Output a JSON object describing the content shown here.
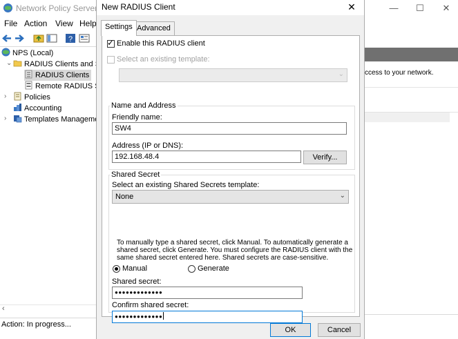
{
  "background_window": {
    "title": "Network Policy Server",
    "menu": [
      "File",
      "Action",
      "View",
      "Help"
    ],
    "tree": [
      {
        "label": "NPS (Local)"
      },
      {
        "label": "RADIUS Clients and Se"
      },
      {
        "label": "RADIUS Clients"
      },
      {
        "label": "Remote RADIUS Se"
      },
      {
        "label": "Policies"
      },
      {
        "label": "Accounting"
      },
      {
        "label": "Templates Manageme"
      }
    ],
    "status": "Action:  In progress...",
    "right_pane_text": "ccess to your network.",
    "caption_buttons": {
      "minimize": "—",
      "maximize": "☐",
      "close": "✕"
    }
  },
  "dialog": {
    "title": "New RADIUS Client",
    "close_glyph": "✕",
    "tabs": [
      "Settings",
      "Advanced"
    ],
    "enable_label": "Enable this RADIUS client",
    "enable_checked": true,
    "template_label": "Select an existing template:",
    "template_checked": false,
    "template_value": "",
    "name_group": "Name and Address",
    "friendly_label": "Friendly name:",
    "friendly_value": "SW4",
    "address_label": "Address (IP or DNS):",
    "address_value": "192.168.48.4",
    "verify_label": "Verify...",
    "secret_group": "Shared Secret",
    "secret_template_label": "Select an existing Shared Secrets template:",
    "secret_template_value": "None",
    "description": "To manually type a shared secret, click Manual. To automatically generate a shared secret, click Generate. You must configure the RADIUS client with the same shared secret entered here. Shared secrets are case-sensitive.",
    "manual_label": "Manual",
    "generate_label": "Generate",
    "selected_mode": "Manual",
    "shared_secret_label": "Shared secret:",
    "shared_secret_value": "●●●●●●●●●●●●●",
    "confirm_label": "Confirm shared secret:",
    "confirm_value": "●●●●●●●●●●●●●",
    "ok_label": "OK",
    "cancel_label": "Cancel"
  },
  "colors": {
    "accent": "#0078d7",
    "selection": "#d9d9d9"
  }
}
